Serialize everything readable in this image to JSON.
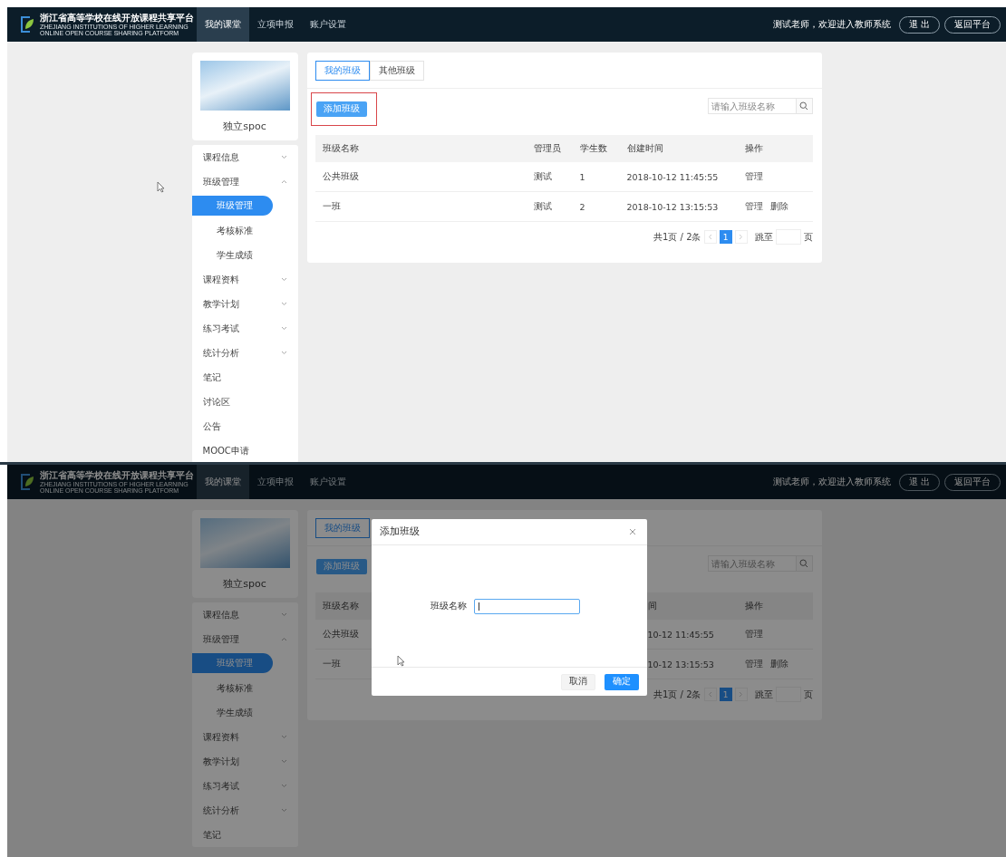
{
  "screens": [
    {
      "header": {
        "title": "浙江省高等学校在线开放课程共享平台",
        "subtitle": "ZHEJIANG INSTITUTIONS OF HIGHER LEARNING ONLINE OPEN COURSE SHARING PLATFORM",
        "nav": [
          {
            "label": "我的课堂",
            "selected": true
          },
          {
            "label": "立项申报",
            "selected": false
          },
          {
            "label": "账户设置",
            "selected": false
          }
        ],
        "greeting": "测试老师，欢迎进入教师系统",
        "buttons": [
          "退 出",
          "返回平台"
        ]
      },
      "sidebar": {
        "course_name": "独立spoc",
        "items": [
          {
            "label": "课程信息",
            "expanded": false
          },
          {
            "label": "班级管理",
            "expanded": true,
            "children": [
              {
                "label": "班级管理",
                "selected": true
              },
              {
                "label": "考核标准",
                "selected": false
              },
              {
                "label": "学生成绩",
                "selected": false
              }
            ]
          },
          {
            "label": "课程资料",
            "expanded": false
          },
          {
            "label": "教学计划",
            "expanded": false
          },
          {
            "label": "练习考试",
            "expanded": false
          },
          {
            "label": "统计分析",
            "expanded": false
          },
          {
            "label": "笔记"
          },
          {
            "label": "讨论区"
          },
          {
            "label": "公告"
          },
          {
            "label": "MOOC申请"
          }
        ]
      },
      "content": {
        "tabs": [
          {
            "label": "我的班级",
            "selected": true
          },
          {
            "label": "其他班级",
            "selected": false
          }
        ],
        "add_button": {
          "label": "添加班级",
          "annotated": true
        },
        "search": {
          "placeholder": "请输入班级名称"
        },
        "table": {
          "columns": [
            "班级名称",
            "管理员",
            "学生数",
            "创建时间",
            "操作"
          ],
          "rows": [
            {
              "cells": [
                "公共班级",
                "测试",
                "1",
                "2018-10-12 11:45:55"
              ],
              "actions": [
                "管理"
              ]
            },
            {
              "cells": [
                "一班",
                "测试",
                "2",
                "2018-10-12 13:15:53"
              ],
              "actions": [
                "管理",
                "删除"
              ]
            }
          ]
        },
        "pagination": {
          "summary": "共1页 / 2条",
          "pages": [
            {
              "label": "1",
              "selected": true
            }
          ],
          "jump_label": "跳至",
          "page_unit": "页"
        }
      }
    },
    {
      "header": {
        "title": "浙江省高等学校在线开放课程共享平台",
        "subtitle": "ZHEJIANG INSTITUTIONS OF HIGHER LEARNING ONLINE OPEN COURSE SHARING PLATFORM",
        "nav": [
          {
            "label": "我的课堂",
            "selected": true
          },
          {
            "label": "立项申报",
            "selected": false
          },
          {
            "label": "账户设置",
            "selected": false
          }
        ],
        "greeting": "测试老师，欢迎进入教师系统",
        "buttons": [
          "退 出",
          "返回平台"
        ]
      },
      "sidebar": {
        "course_name": "独立spoc",
        "items": [
          {
            "label": "课程信息",
            "expanded": false
          },
          {
            "label": "班级管理",
            "expanded": true,
            "children": [
              {
                "label": "班级管理",
                "selected": true
              },
              {
                "label": "考核标准",
                "selected": false
              },
              {
                "label": "学生成绩",
                "selected": false
              }
            ]
          },
          {
            "label": "课程资料",
            "expanded": false
          },
          {
            "label": "教学计划",
            "expanded": false
          },
          {
            "label": "练习考试",
            "expanded": false
          },
          {
            "label": "统计分析",
            "expanded": false
          },
          {
            "label": "笔记"
          }
        ]
      },
      "content": {
        "tabs": [
          {
            "label": "我的班级",
            "selected": true
          }
        ],
        "add_button": {
          "label": "添加班级",
          "annotated": false
        },
        "search": {
          "placeholder": "请输入班级名称"
        },
        "table": {
          "columns": [
            "班级名称",
            "间",
            "操作"
          ],
          "rows": [
            {
              "cells": [
                "公共班级",
                "10-12 11:45:55"
              ],
              "actions": [
                "管理"
              ]
            },
            {
              "cells": [
                "一班",
                "10-12 13:15:53"
              ],
              "actions": [
                "管理",
                "删除"
              ]
            }
          ]
        },
        "pagination": {
          "summary": "共1页 / 2条",
          "pages": [
            {
              "label": "1",
              "selected": true
            }
          ],
          "jump_label": "跳至",
          "page_unit": "页"
        }
      },
      "modal": {
        "title": "添加班级",
        "field_label": "班级名称",
        "buttons": [
          {
            "label": "取消",
            "kind": "secondary"
          },
          {
            "label": "确定",
            "kind": "primary"
          }
        ]
      }
    }
  ]
}
